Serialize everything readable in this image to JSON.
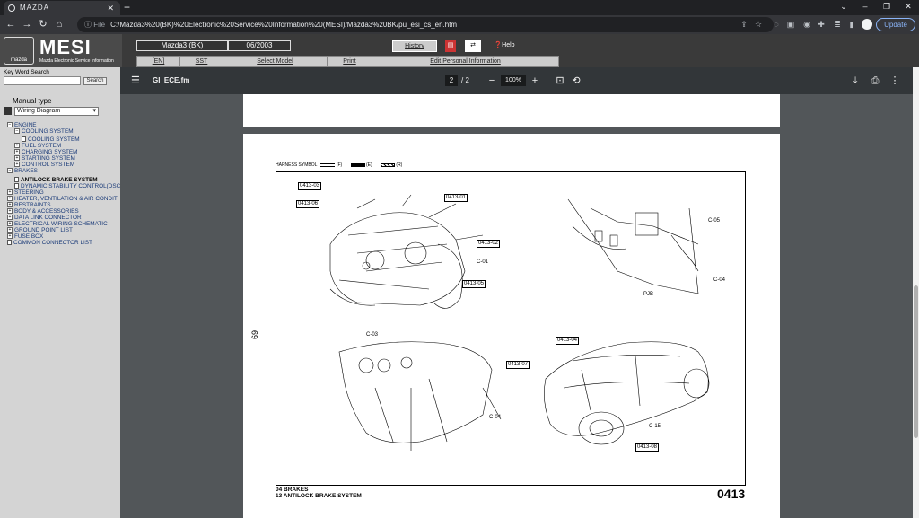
{
  "browser": {
    "tab_title": "MAZDA",
    "new_tab": "+",
    "address_label": "File",
    "address_path": "C:/Mazda3%20(BK)%20Electronic%20Service%20Information%20(MESI)/Mazda3%20BK/pu_esi_cs_en.htm",
    "update_label": "Update"
  },
  "mesi": {
    "logo_text": "MESI",
    "logo_sub": "Mazda Electronic Service Information",
    "brand_small": "mazda",
    "model": "Mazda3 (BK)",
    "date": "06/2003",
    "history": "History",
    "help": "Help",
    "menu": [
      "[EN]",
      "SST",
      "Select Model",
      "Print",
      "Edit Personal Information"
    ]
  },
  "left": {
    "keyword_label": "Key Word Search",
    "search_btn": "Search",
    "manual_type_label": "Manual type",
    "manual_type_value": "Wiring Diagram",
    "tree": [
      {
        "label": "ENGINE",
        "kind": "minus"
      },
      {
        "label": "COOLING SYSTEM",
        "kind": "minus"
      },
      {
        "label": "COOLING SYSTEM",
        "kind": "doc"
      },
      {
        "label": "FUEL SYSTEM",
        "kind": "plus"
      },
      {
        "label": "CHARGING SYSTEM",
        "kind": "plus"
      },
      {
        "label": "STARTING SYSTEM",
        "kind": "plus"
      },
      {
        "label": "CONTROL SYSTEM",
        "kind": "plus"
      },
      {
        "label": "BRAKES",
        "kind": "minus"
      },
      {
        "label": "ANTILOCK BRAKE SYSTEM",
        "kind": "doc"
      },
      {
        "label": "DYNAMIC STABILITY CONTROL(DSC)",
        "kind": "doc"
      },
      {
        "label": "STEERING",
        "kind": "plus"
      },
      {
        "label": "HEATER, VENTILATION & AIR CONDIT",
        "kind": "plus"
      },
      {
        "label": "RESTRAINTS",
        "kind": "plus"
      },
      {
        "label": "BODY & ACCESSORIES",
        "kind": "plus"
      },
      {
        "label": "DATA LINK CONNECTOR",
        "kind": "plus"
      },
      {
        "label": "ELECTRICAL WIRING SCHEMATIC",
        "kind": "plus"
      },
      {
        "label": "GROUND POINT LIST",
        "kind": "plus"
      },
      {
        "label": "FUSE BOX",
        "kind": "plus"
      },
      {
        "label": "COMMON CONNECTOR LIST",
        "kind": "doc"
      }
    ]
  },
  "pdf": {
    "file_name": "GI_ECE.fm",
    "page_current": "2",
    "page_sep": "/",
    "page_total": "2",
    "zoom": "100%"
  },
  "diagram": {
    "legend": "HARNESS SYMBOL :",
    "legend_f": "(F)",
    "legend_e": "(E)",
    "legend_r": "(R)",
    "side_number": "69",
    "footer_line1": "04  BRAKES",
    "footer_line2": "13  ANTILOCK BRAKE SYSTEM",
    "page_code": "0413",
    "refs": [
      "0413-03",
      "0413-06",
      "0413-01",
      "0413-02",
      "0413-05",
      "0413-04",
      "0413-07",
      "0413-08"
    ],
    "labels": [
      "C-01",
      "C-05",
      "C-04",
      "PJB",
      "C-03",
      "C-04",
      "C-15"
    ]
  }
}
